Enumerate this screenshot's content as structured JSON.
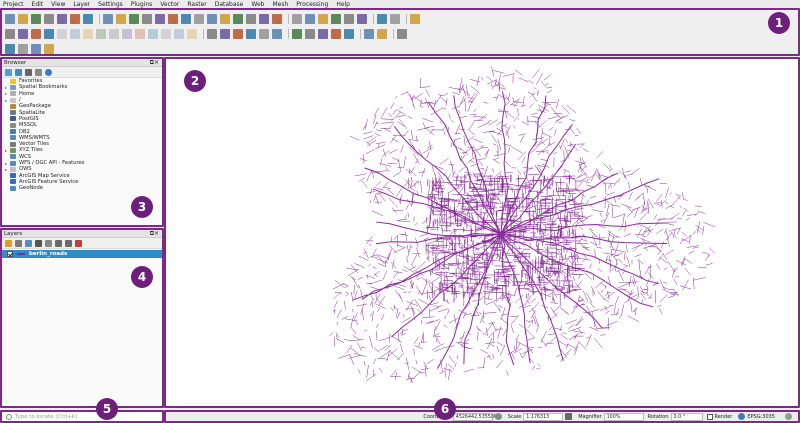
{
  "menubar": {
    "items": [
      "Project",
      "Edit",
      "View",
      "Layer",
      "Settings",
      "Plugins",
      "Vector",
      "Raster",
      "Database",
      "Web",
      "Mesh",
      "Processing",
      "Help"
    ]
  },
  "browser": {
    "title": "Browser",
    "items": [
      {
        "label": "Favorites",
        "icon": "star-icon",
        "color": "#f2c230",
        "expandable": false
      },
      {
        "label": "Spatial Bookmarks",
        "icon": "bookmark-icon",
        "color": "#7a9cc6",
        "expandable": true
      },
      {
        "label": "Home",
        "icon": "home-icon",
        "color": "#b0b0b0",
        "expandable": true
      },
      {
        "label": "/",
        "icon": "folder-icon",
        "color": "#c8c8c8",
        "expandable": true
      },
      {
        "label": "GeoPackage",
        "icon": "geopackage-icon",
        "color": "#b48a3c",
        "expandable": false
      },
      {
        "label": "SpatiaLite",
        "icon": "spatialite-icon",
        "color": "#6a7d8a",
        "expandable": false
      },
      {
        "label": "PostGIS",
        "icon": "postgis-icon",
        "color": "#3b5e8a",
        "expandable": false
      },
      {
        "label": "MSSQL",
        "icon": "mssql-icon",
        "color": "#8a8a8a",
        "expandable": false
      },
      {
        "label": "DB2",
        "icon": "db2-icon",
        "color": "#4a7aa8",
        "expandable": false
      },
      {
        "label": "WMS/WMTS",
        "icon": "wms-icon",
        "color": "#5a8ab0",
        "expandable": false
      },
      {
        "label": "Vector Tiles",
        "icon": "vector-tiles-icon",
        "color": "#7a7a7a",
        "expandable": false
      },
      {
        "label": "XYZ Tiles",
        "icon": "xyz-tiles-icon",
        "color": "#6a9a5a",
        "expandable": true
      },
      {
        "label": "WCS",
        "icon": "wcs-icon",
        "color": "#5a8ab0",
        "expandable": false
      },
      {
        "label": "WFS / OGC API - Features",
        "icon": "wfs-icon",
        "color": "#5a8ab0",
        "expandable": true
      },
      {
        "label": "OWS",
        "icon": "ows-icon",
        "color": "#c0c0c0",
        "expandable": true
      },
      {
        "label": "ArcGIS Map Service",
        "icon": "arcgis-map-icon",
        "color": "#3a6ab0",
        "expandable": false
      },
      {
        "label": "ArcGIS Feature Service",
        "icon": "arcgis-feature-icon",
        "color": "#3a6ab0",
        "expandable": false
      },
      {
        "label": "GeoNode",
        "icon": "geonode-icon",
        "color": "#4a8ac0",
        "expandable": false
      }
    ]
  },
  "layers": {
    "title": "Layers",
    "items": [
      {
        "label": "berlin_roads",
        "checked": true,
        "color": "#8a2a9a"
      }
    ]
  },
  "locator": {
    "placeholder": "Type to locate (Ctrl+K)"
  },
  "statusbar": {
    "coordinate_label": "Coordinate",
    "coordinate_value": "4526442,5355003",
    "scale_label": "Scale",
    "scale_value": "1:176313",
    "magnifier_label": "Magnifier",
    "magnifier_value": "100%",
    "rotation_label": "Rotation",
    "rotation_value": "0.0 °",
    "render_label": "Render",
    "crs_value": "EPSG:3035"
  },
  "annotations": [
    "1",
    "2",
    "3",
    "4",
    "5",
    "6"
  ],
  "theme": {
    "zone_border": "#7b2b86",
    "badge": "#6d1f7c",
    "road_color": "#8a2a9a",
    "selection": "#308cc6"
  }
}
